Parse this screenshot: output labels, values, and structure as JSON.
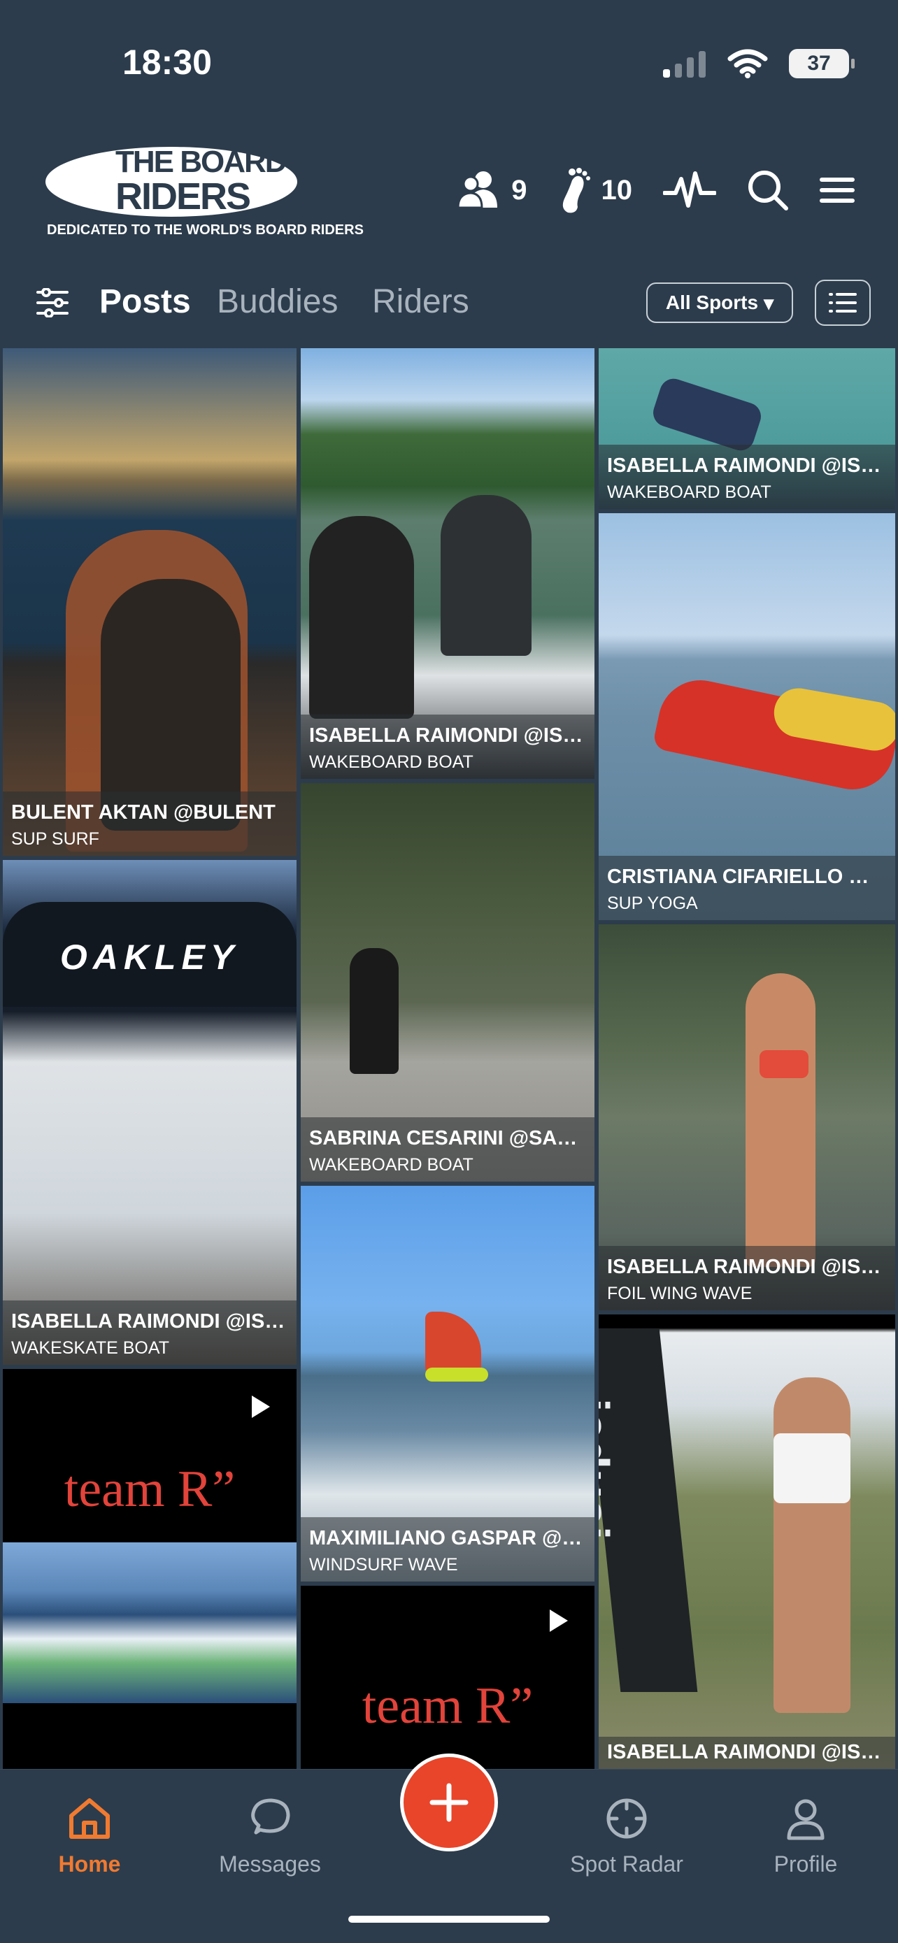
{
  "status_bar": {
    "time": "18:30",
    "battery": "37"
  },
  "header": {
    "logo": {
      "line1": "THE BOARD",
      "line2": "RIDERS",
      "tagline": "DEDICATED TO THE WORLD'S BOARD RIDERS"
    },
    "buddies_count": "9",
    "footprints_count": "10"
  },
  "tabs": {
    "posts": "Posts",
    "buddies": "Buddies",
    "riders": "Riders"
  },
  "sport_filter": {
    "selected": "All Sports",
    "arrow": "▾"
  },
  "posts": [
    {
      "name": "BULENT AKTAN @BULENT",
      "sport": "SUP SURF"
    },
    {
      "name": "ISABELLA RAIMONDI @ISABELLA",
      "sport": "WAKESKATE BOAT"
    },
    {
      "name": "ISABELLA RAIMONDI @ISABELLA",
      "sport": "WAKEBOARD BOAT"
    },
    {
      "name": "SABRINA CESARINI @SABRINA",
      "sport": "WAKEBOARD BOAT"
    },
    {
      "name": "MAXIMILIANO GASPAR @MAXIMILIANO",
      "sport": "WINDSURF WAVE"
    },
    {
      "name": "ISABELLA RAIMONDI @ISABELLA",
      "sport": "WAKEBOARD BOAT"
    },
    {
      "name": "CRISTIANA CIFARIELLO @CRISTIANA",
      "sport": "SUP YOGA"
    },
    {
      "name": "ISABELLA RAIMONDI @ISABELLA",
      "sport": "FOIL WING WAVE"
    },
    {
      "name": "ISABELLA RAIMONDI @ISABELLA",
      "sport": ""
    }
  ],
  "media": {
    "oakley": "OAKLEY",
    "team_r": "team R”",
    "banner": "icduai"
  },
  "nav": {
    "home": "Home",
    "messages": "Messages",
    "spot_radar": "Spot Radar",
    "profile": "Profile"
  },
  "colors": {
    "background": "#2c3c4c",
    "accent": "#f07a30",
    "add_button": "#e8452a"
  }
}
